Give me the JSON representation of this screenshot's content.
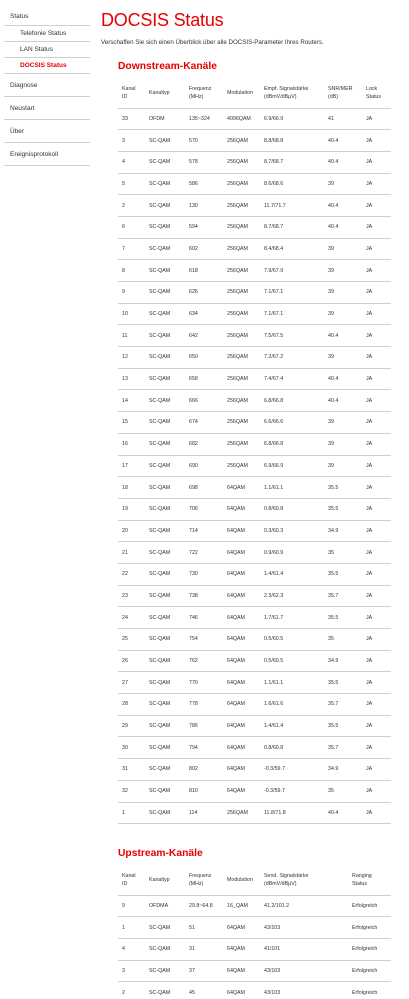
{
  "sidebar": {
    "status": "Status",
    "telefonie_status": "Telefonie Status",
    "lan_status": "LAN Status",
    "docsis_status": "DOCSIS Status",
    "diagnose": "Diagnose",
    "neustart": "Neustart",
    "ueber": "Über",
    "ereignisprotokoll": "Ereignisprotokoll"
  },
  "page": {
    "title": "DOCSIS Status",
    "subtitle": "Verschaffen Sie sich einen Überblick über alle DOCSIS-Parameter Ihres Routers."
  },
  "downstream": {
    "title": "Downstream-Kanäle",
    "headers": {
      "kanal_id_1": "Kanal",
      "kanal_id_2": "ID",
      "kanaltyp": "Kanaltyp",
      "frequenz_1": "Frequenz",
      "frequenz_2": "(MHz)",
      "modulation": "Modulation",
      "signal_1": "Empf. Signalstärke",
      "signal_2": "(dBmV/dBµV)",
      "snr_1": "SNR/MER",
      "snr_2": "(dB)",
      "lock_1": "Lock",
      "lock_2": "Status"
    },
    "rows": [
      {
        "id": "33",
        "type": "OFDM",
        "freq": "135~324",
        "mod": "4096QAM",
        "signal": "6.9/66.9",
        "snr": "41",
        "lock": "JA"
      },
      {
        "id": "3",
        "type": "SC-QAM",
        "freq": "570",
        "mod": "256QAM",
        "signal": "8.8/68.8",
        "snr": "40.4",
        "lock": "JA"
      },
      {
        "id": "4",
        "type": "SC-QAM",
        "freq": "578",
        "mod": "256QAM",
        "signal": "8.7/68.7",
        "snr": "40.4",
        "lock": "JA"
      },
      {
        "id": "5",
        "type": "SC-QAM",
        "freq": "586",
        "mod": "256QAM",
        "signal": "8.6/68.6",
        "snr": "39",
        "lock": "JA"
      },
      {
        "id": "2",
        "type": "SC-QAM",
        "freq": "130",
        "mod": "256QAM",
        "signal": "11.7/71.7",
        "snr": "40.4",
        "lock": "JA"
      },
      {
        "id": "6",
        "type": "SC-QAM",
        "freq": "594",
        "mod": "256QAM",
        "signal": "8.7/68.7",
        "snr": "40.4",
        "lock": "JA"
      },
      {
        "id": "7",
        "type": "SC-QAM",
        "freq": "602",
        "mod": "256QAM",
        "signal": "8.4/68.4",
        "snr": "39",
        "lock": "JA"
      },
      {
        "id": "8",
        "type": "SC-QAM",
        "freq": "618",
        "mod": "256QAM",
        "signal": "7.9/67.9",
        "snr": "39",
        "lock": "JA"
      },
      {
        "id": "9",
        "type": "SC-QAM",
        "freq": "626",
        "mod": "256QAM",
        "signal": "7.1/67.1",
        "snr": "39",
        "lock": "JA"
      },
      {
        "id": "10",
        "type": "SC-QAM",
        "freq": "634",
        "mod": "256QAM",
        "signal": "7.1/67.1",
        "snr": "39",
        "lock": "JA"
      },
      {
        "id": "11",
        "type": "SC-QAM",
        "freq": "642",
        "mod": "256QAM",
        "signal": "7.5/67.5",
        "snr": "40.4",
        "lock": "JA"
      },
      {
        "id": "12",
        "type": "SC-QAM",
        "freq": "650",
        "mod": "256QAM",
        "signal": "7.2/67.2",
        "snr": "39",
        "lock": "JA"
      },
      {
        "id": "13",
        "type": "SC-QAM",
        "freq": "658",
        "mod": "256QAM",
        "signal": "7.4/67.4",
        "snr": "40.4",
        "lock": "JA"
      },
      {
        "id": "14",
        "type": "SC-QAM",
        "freq": "666",
        "mod": "256QAM",
        "signal": "6.8/66.8",
        "snr": "40.4",
        "lock": "JA"
      },
      {
        "id": "15",
        "type": "SC-QAM",
        "freq": "674",
        "mod": "256QAM",
        "signal": "6.6/66.6",
        "snr": "39",
        "lock": "JA"
      },
      {
        "id": "16",
        "type": "SC-QAM",
        "freq": "682",
        "mod": "256QAM",
        "signal": "6.8/66.8",
        "snr": "39",
        "lock": "JA"
      },
      {
        "id": "17",
        "type": "SC-QAM",
        "freq": "690",
        "mod": "256QAM",
        "signal": "6.9/66.9",
        "snr": "39",
        "lock": "JA"
      },
      {
        "id": "18",
        "type": "SC-QAM",
        "freq": "698",
        "mod": "64QAM",
        "signal": "1.1/61.1",
        "snr": "35.5",
        "lock": "JA"
      },
      {
        "id": "19",
        "type": "SC-QAM",
        "freq": "706",
        "mod": "64QAM",
        "signal": "0.8/60.8",
        "snr": "35.5",
        "lock": "JA"
      },
      {
        "id": "20",
        "type": "SC-QAM",
        "freq": "714",
        "mod": "64QAM",
        "signal": "0.3/60.3",
        "snr": "34.9",
        "lock": "JA"
      },
      {
        "id": "21",
        "type": "SC-QAM",
        "freq": "722",
        "mod": "64QAM",
        "signal": "0.9/60.9",
        "snr": "35",
        "lock": "JA"
      },
      {
        "id": "22",
        "type": "SC-QAM",
        "freq": "730",
        "mod": "64QAM",
        "signal": "1.4/61.4",
        "snr": "35.5",
        "lock": "JA"
      },
      {
        "id": "23",
        "type": "SC-QAM",
        "freq": "738",
        "mod": "64QAM",
        "signal": "2.3/62.3",
        "snr": "35.7",
        "lock": "JA"
      },
      {
        "id": "24",
        "type": "SC-QAM",
        "freq": "746",
        "mod": "64QAM",
        "signal": "1.7/61.7",
        "snr": "35.5",
        "lock": "JA"
      },
      {
        "id": "25",
        "type": "SC-QAM",
        "freq": "754",
        "mod": "64QAM",
        "signal": "0.5/60.5",
        "snr": "35",
        "lock": "JA"
      },
      {
        "id": "26",
        "type": "SC-QAM",
        "freq": "762",
        "mod": "64QAM",
        "signal": "0.5/60.5",
        "snr": "34.9",
        "lock": "JA"
      },
      {
        "id": "27",
        "type": "SC-QAM",
        "freq": "770",
        "mod": "64QAM",
        "signal": "1.1/61.1",
        "snr": "35.5",
        "lock": "JA"
      },
      {
        "id": "28",
        "type": "SC-QAM",
        "freq": "778",
        "mod": "64QAM",
        "signal": "1.6/61.6",
        "snr": "35.7",
        "lock": "JA"
      },
      {
        "id": "29",
        "type": "SC-QAM",
        "freq": "786",
        "mod": "64QAM",
        "signal": "1.4/61.4",
        "snr": "35.5",
        "lock": "JA"
      },
      {
        "id": "30",
        "type": "SC-QAM",
        "freq": "794",
        "mod": "64QAM",
        "signal": "0.8/60.8",
        "snr": "35.7",
        "lock": "JA"
      },
      {
        "id": "31",
        "type": "SC-QAM",
        "freq": "802",
        "mod": "64QAM",
        "signal": "-0.3/59.7",
        "snr": "34.9",
        "lock": "JA"
      },
      {
        "id": "32",
        "type": "SC-QAM",
        "freq": "810",
        "mod": "64QAM",
        "signal": "-0.3/59.7",
        "snr": "35",
        "lock": "JA"
      },
      {
        "id": "1",
        "type": "SC-QAM",
        "freq": "114",
        "mod": "256QAM",
        "signal": "11.8/71.8",
        "snr": "40.4",
        "lock": "JA"
      }
    ]
  },
  "upstream": {
    "title": "Upstream-Kanäle",
    "headers": {
      "kanal_id_1": "Kanal",
      "kanal_id_2": "ID",
      "kanaltyp": "Kanaltyp",
      "frequenz_1": "Frequenz",
      "frequenz_2": "(MHz)",
      "modulation": "Modulation",
      "signal_1": "Send. Signalstärke",
      "signal_2": "(dBmV/dBµV)",
      "ranging_1": "Ranging",
      "ranging_2": "Status"
    },
    "rows": [
      {
        "id": "9",
        "type": "OFDMA",
        "freq": "29.8~64.8",
        "mod": "16_QAM",
        "signal": "41.2/101.2",
        "status": "Erfolgreich"
      },
      {
        "id": "1",
        "type": "SC-QAM",
        "freq": "51",
        "mod": "64QAM",
        "signal": "43/103",
        "status": "Erfolgreich"
      },
      {
        "id": "4",
        "type": "SC-QAM",
        "freq": "31",
        "mod": "64QAM",
        "signal": "41/101",
        "status": "Erfolgreich"
      },
      {
        "id": "3",
        "type": "SC-QAM",
        "freq": "37",
        "mod": "64QAM",
        "signal": "43/103",
        "status": "Erfolgreich"
      },
      {
        "id": "2",
        "type": "SC-QAM",
        "freq": "45",
        "mod": "64QAM",
        "signal": "43/103",
        "status": "Erfolgreich"
      }
    ]
  },
  "colors": {
    "accent": "#e60000",
    "text": "#333333",
    "divider": "#cfcfcf"
  }
}
